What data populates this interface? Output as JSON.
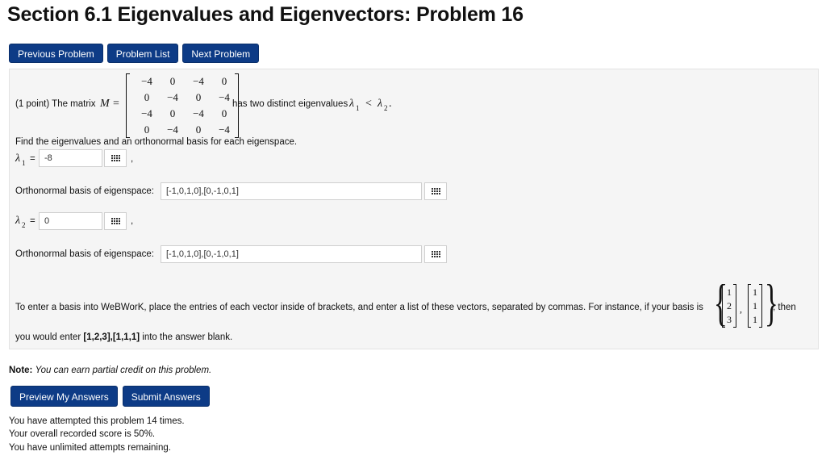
{
  "page": {
    "title": "Section 6.1 Eigenvalues and Eigenvectors: Problem 16"
  },
  "nav": {
    "previous": "Previous Problem",
    "list": "Problem List",
    "next": "Next Problem"
  },
  "problem": {
    "intro": "(1 point) The matrix",
    "matrix_symbol": "M",
    "equals": "=",
    "matrix": [
      [
        "−4",
        "0",
        "−4",
        "0"
      ],
      [
        "0",
        "−4",
        "0",
        "−4"
      ],
      [
        "−4",
        "0",
        "−4",
        "0"
      ],
      [
        "0",
        "−4",
        "0",
        "−4"
      ]
    ],
    "after_matrix_prefix": "has two distinct eigenvalues",
    "lambda1": "λ",
    "sub1": "1",
    "less": "<",
    "lambda2": "λ",
    "sub2": "2",
    "period": ".",
    "instruction": "Find the eigenvalues and an orthonormal basis for each eigenspace.",
    "eq_sign": "=",
    "comma": ",",
    "answers": {
      "lambda1_value": "-8",
      "basis1_label": "Orthonormal basis of eigenspace:",
      "basis1_value": "[-1,0,1,0],[0,-1,0,1]",
      "lambda2_value": "0",
      "basis2_label": "Orthonormal basis of eigenspace:",
      "basis2_value": "[-1,0,1,0],[0,-1,0,1]"
    },
    "hint": {
      "text_before": "To enter a basis into WeBWorK, place the entries of each vector inside of brackets, and enter a list of these vectors, separated by commas. For instance, if your basis is",
      "vec1": [
        "1",
        "2",
        "3"
      ],
      "vec2": [
        "1",
        "1",
        "1"
      ],
      "then": ", then",
      "line2_before": "you would enter",
      "example": "[1,2,3],[1,1,1]",
      "line2_after": "into the answer blank."
    }
  },
  "note": {
    "label": "Note:",
    "text": "You can earn partial credit on this problem."
  },
  "actions": {
    "preview": "Preview My Answers",
    "submit": "Submit Answers"
  },
  "status": {
    "attempts": "You have attempted this problem 14 times.",
    "score": "Your overall recorded score is 50%.",
    "remaining": "You have unlimited attempts remaining."
  }
}
